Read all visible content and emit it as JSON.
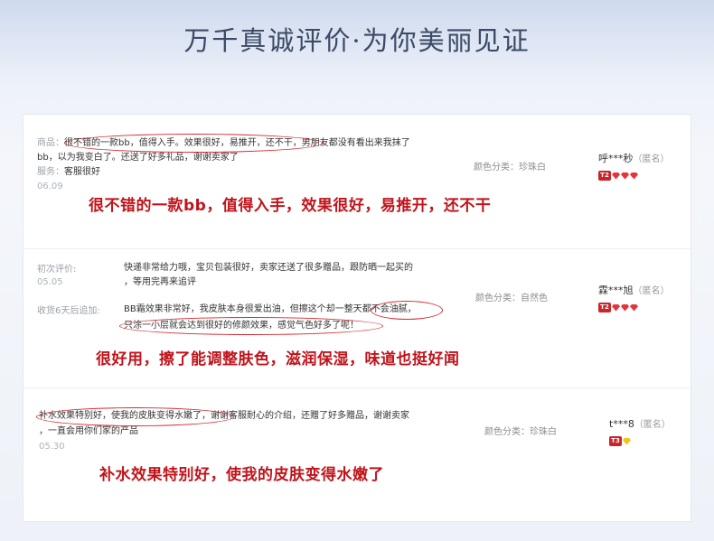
{
  "header": {
    "title": "万千真诚评价·为你美丽见证"
  },
  "reviews": [
    {
      "label_product": "商品：",
      "text_line1": "很不错的一款bb，值得入手。效果很好，易推开，还不干，男朋友都没有看出来我抹了",
      "text_line2": "bb，以为我变白了。还送了好多礼品，谢谢卖家了",
      "label_service": "服务：",
      "service_value": "客服很好",
      "date": "06.09",
      "spec": "颜色分类：珍珠白",
      "user": "呼***秒",
      "anon": "（匿名）",
      "level": "T2",
      "highlight": "很不错的一款bb，值得入手，效果很好，易推开，还不干"
    },
    {
      "label_first": "初次评价:",
      "first_line1": "快递非常给力哦，宝贝包装很好，卖家还送了很多赠品，跟防晒一起买的",
      "first_line2": "，等用完再来追评",
      "first_date": "05.05",
      "label_follow": "收货6天后追加:",
      "follow_line1": "BB霜效果非常好，我皮肤本身很爱出油，但擦这个却一整天都不会油腻，",
      "follow_line2": "只涂一小层就会达到很好的修颜效果，感觉气色好多了呢！",
      "spec": "颜色分类：自然色",
      "user": "霖***旭",
      "anon": "（匿名）",
      "level": "T2",
      "highlight": "很好用，擦了能调整肤色，滋润保湿，味道也挺好闻"
    },
    {
      "text_line1": "补水效果特别好，使我的皮肤变得水嫩了，谢谢客服耐心的介绍，还赠了好多赠品，谢谢卖家",
      "text_line2": "，一直会用你们家的产品",
      "date": "05.30",
      "spec": "颜色分类：珍珠白",
      "user": "t***8",
      "anon": "（匿名）",
      "level": "T3",
      "highlight": "补水效果特别好，使我的皮肤变得水嫩了"
    }
  ]
}
